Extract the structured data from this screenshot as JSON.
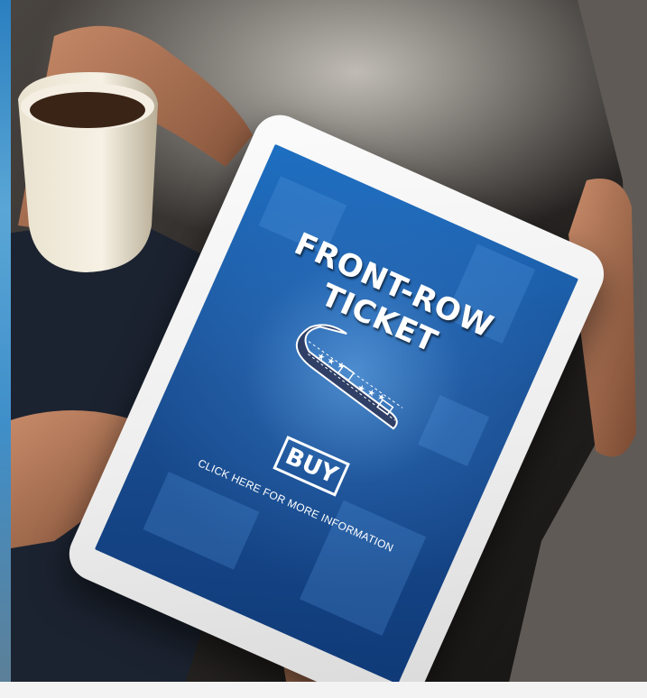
{
  "screen": {
    "title": "FRONT-ROW TICKET",
    "buy_label": "BUY",
    "info_text": "CLICK HERE FOR MORE INFORMATION"
  },
  "colors": {
    "screen_blue": "#1a4f93",
    "nail_polish": "#b4305a",
    "coffee": "#3a2416"
  }
}
